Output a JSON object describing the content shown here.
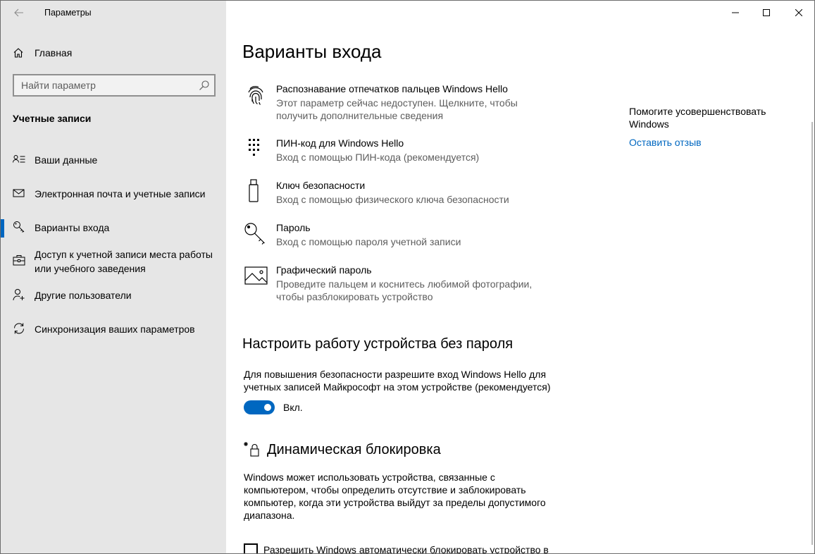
{
  "window": {
    "app_title": "Параметры",
    "controls": {
      "minimize": "minimize-icon",
      "maximize": "maximize-icon",
      "close": "close-icon"
    }
  },
  "sidebar": {
    "home_label": "Главная",
    "search": {
      "placeholder": "Найти параметр",
      "value": ""
    },
    "section_title": "Учетные записи",
    "items": [
      {
        "label": "Ваши данные",
        "icon": "person-card-icon",
        "selected": false
      },
      {
        "label": "Электронная почта и учетные записи",
        "icon": "mail-icon",
        "selected": false
      },
      {
        "label": "Варианты входа",
        "icon": "key-icon",
        "selected": true
      },
      {
        "label": "Доступ к учетной записи места работы или учебного заведения",
        "icon": "briefcase-icon",
        "selected": false
      },
      {
        "label": "Другие пользователи",
        "icon": "person-add-icon",
        "selected": false
      },
      {
        "label": "Синхронизация ваших параметров",
        "icon": "sync-icon",
        "selected": false
      }
    ]
  },
  "main": {
    "title": "Варианты входа",
    "options": [
      {
        "title": "Распознавание отпечатков пальцев Windows Hello",
        "desc": "Этот параметр сейчас недоступен. Щелкните, чтобы получить дополнительные сведения",
        "icon": "fingerprint-icon"
      },
      {
        "title": "ПИН-код для Windows Hello",
        "desc": "Вход с помощью ПИН-кода (рекомендуется)",
        "icon": "pin-keypad-icon"
      },
      {
        "title": "Ключ безопасности",
        "desc": "Вход с помощью физического ключа безопасности",
        "icon": "usb-key-icon"
      },
      {
        "title": "Пароль",
        "desc": "Вход с помощью пароля учетной записи",
        "icon": "password-key-icon"
      },
      {
        "title": "Графический пароль",
        "desc": "Проведите пальцем и коснитесь любимой фотографии, чтобы разблокировать устройство",
        "icon": "picture-icon"
      }
    ],
    "passwordless": {
      "heading": "Настроить работу устройства без пароля",
      "description": "Для повышения безопасности разрешите вход Windows Hello для учетных записей Майкрософт на этом устройстве (рекомендуется)",
      "toggle_state": "on",
      "toggle_label": "Вкл."
    },
    "dynamic_lock": {
      "heading": "Динамическая блокировка",
      "description": "Windows может использовать устройства, связанные с компьютером, чтобы определить отсутствие и заблокировать компьютер, когда эти устройства выйдут за пределы допустимого диапазона.",
      "checkbox_label": "Разрешить Windows автоматически блокировать устройство в",
      "checkbox_checked": false
    }
  },
  "aside": {
    "title": "Помогите усовершенствовать Windows",
    "link": "Оставить отзыв"
  },
  "colors": {
    "accent": "#0067c0",
    "sidebar_bg": "#e6e6e6",
    "secondary_text": "#5d5d5d"
  }
}
